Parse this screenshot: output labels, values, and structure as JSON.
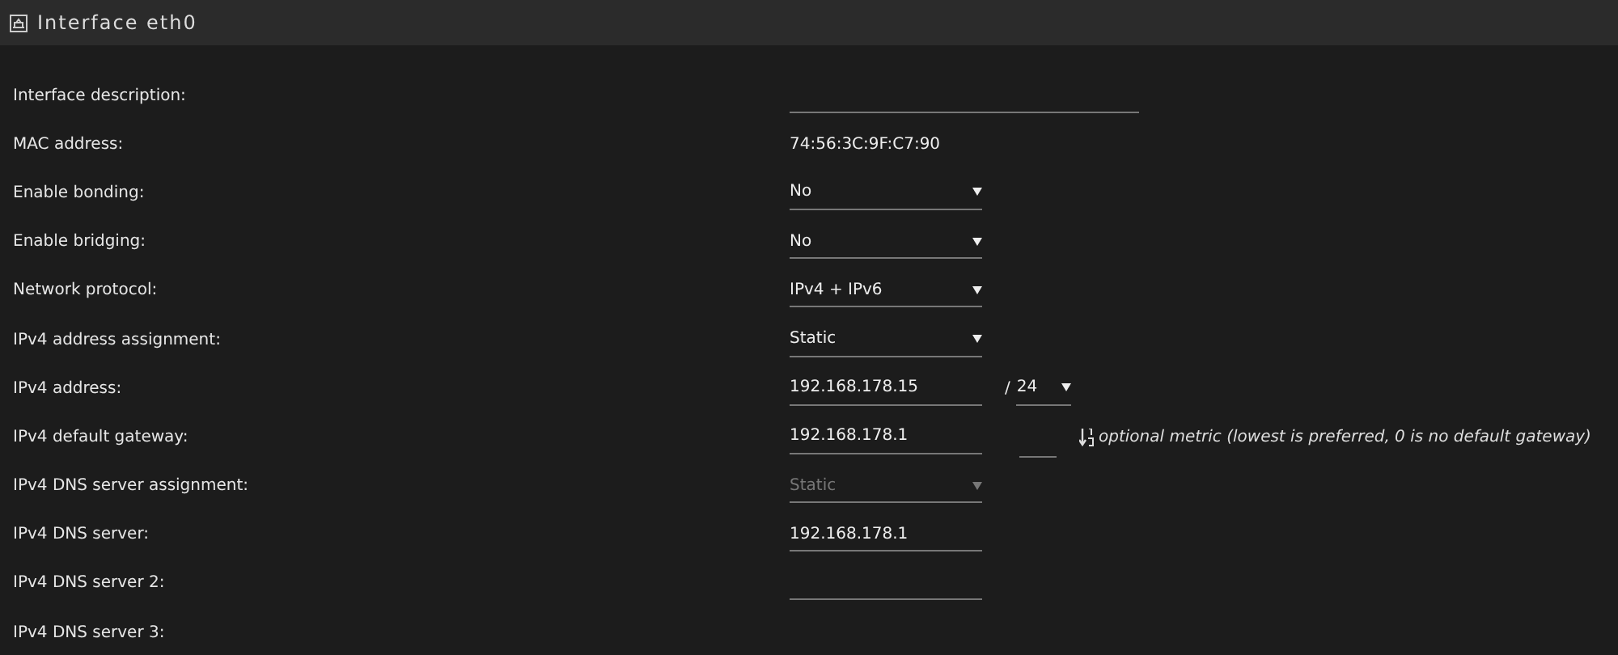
{
  "panel": {
    "title": "Interface eth0"
  },
  "rows": [
    {
      "label": "Interface description:",
      "kind": "input",
      "wide": true,
      "value": ""
    },
    {
      "label": "MAC address:",
      "kind": "static",
      "value": "74:56:3C:9F:C7:90"
    },
    {
      "label": "Enable bonding:",
      "kind": "select",
      "value": "No",
      "disabled": false
    },
    {
      "label": "Enable bridging:",
      "kind": "select",
      "value": "No",
      "disabled": false
    },
    {
      "label": "Network protocol:",
      "kind": "select",
      "value": "IPv4 + IPv6",
      "disabled": false
    },
    {
      "label": "IPv4 address assignment:",
      "kind": "select",
      "value": "Static",
      "disabled": false
    },
    {
      "label": "IPv4 address:",
      "kind": "address",
      "value": "192.168.178.15",
      "separator": "/",
      "prefix": "24"
    },
    {
      "label": "IPv4 default gateway:",
      "kind": "gateway",
      "value": "192.168.178.1",
      "hint": "optional metric (lowest is preferred, 0 is no default gateway)"
    },
    {
      "label": "IPv4 DNS server assignment:",
      "kind": "select",
      "value": "Static",
      "disabled": true
    },
    {
      "label": "IPv4 DNS server:",
      "kind": "input",
      "value": "192.168.178.1"
    },
    {
      "label": "IPv4 DNS server 2:",
      "kind": "input",
      "value": ""
    },
    {
      "label": "IPv4 DNS server 3:",
      "kind": "label"
    }
  ]
}
